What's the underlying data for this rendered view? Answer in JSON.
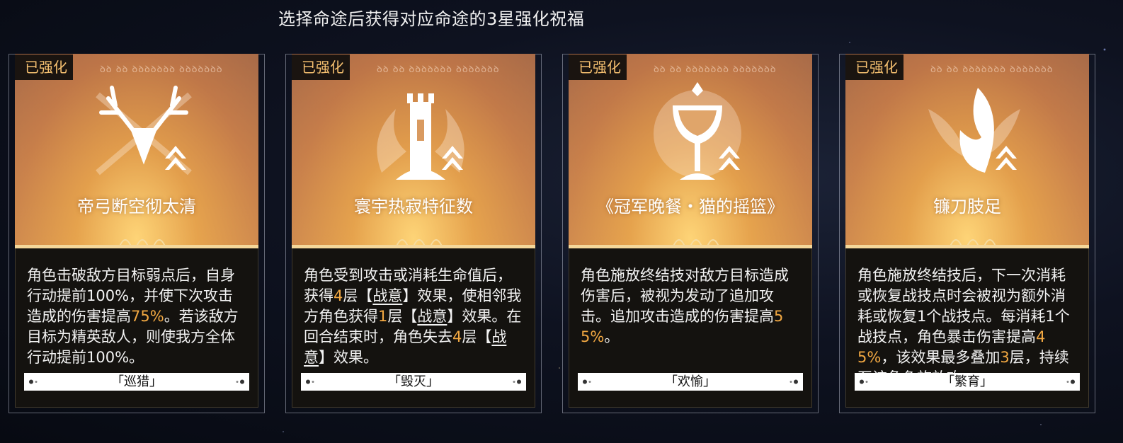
{
  "header": {
    "title": "选择命途后获得对应命途的3星强化祝福"
  },
  "cards": [
    {
      "badge": "已强化",
      "runes": "ꝺꝺ ꝺꝺ ꝺꝺꝺꝺꝺꝺꝺ ꝺꝺꝺꝺꝺꝺꝺ",
      "name": "帝弓断空彻太清",
      "icon": "antler-bow-emblem-icon",
      "desc": [
        {
          "t": "角色击破敌方目标弱点后，自身行动提前100%，并使下次攻击造成的伤害提高"
        },
        {
          "t": "75%",
          "c": "hl"
        },
        {
          "t": "。若该敌方目标为精英敌人，则使我方全体行动提前100%。"
        }
      ],
      "path": "「巡猎」"
    },
    {
      "badge": "已强化",
      "runes": "ꝺꝺ ꝺꝺ ꝺꝺꝺꝺꝺꝺꝺ ꝺꝺꝺꝺꝺꝺꝺ",
      "name": "寰宇热寂特征数",
      "icon": "flaming-tower-emblem-icon",
      "desc": [
        {
          "t": "角色受到攻击或消耗生命值后，获得"
        },
        {
          "t": "4",
          "c": "hl"
        },
        {
          "t": "层【"
        },
        {
          "t": "战意",
          "c": "ul"
        },
        {
          "t": "】效果，使相邻我方角色获得"
        },
        {
          "t": "1",
          "c": "hl"
        },
        {
          "t": "层【"
        },
        {
          "t": "战意",
          "c": "ul"
        },
        {
          "t": "】效果。在回合结束时，角色失去"
        },
        {
          "t": "4",
          "c": "hl"
        },
        {
          "t": "层【"
        },
        {
          "t": "战意",
          "c": "ul"
        },
        {
          "t": "】效果。"
        }
      ],
      "path": "「毁灭」"
    },
    {
      "badge": "已强化",
      "runes": "ꝺꝺ ꝺꝺ ꝺꝺꝺꝺꝺꝺꝺ ꝺꝺꝺꝺꝺꝺꝺ",
      "name": "《冠军晚餐・猫的摇篮》",
      "icon": "goblet-emblem-icon",
      "desc": [
        {
          "t": "角色施放终结技对敌方目标造成伤害后，被视为发动了追加攻击。追加攻击造成的伤害提高"
        },
        {
          "t": "55%",
          "c": "hl"
        },
        {
          "t": "。"
        }
      ],
      "path": "「欢愉」"
    },
    {
      "badge": "已强化",
      "runes": "ꝺꝺ ꝺꝺ ꝺꝺꝺꝺꝺꝺꝺ ꝺꝺꝺꝺꝺꝺꝺ",
      "name": "镰刀肢足",
      "icon": "scythe-limb-emblem-icon",
      "desc": [
        {
          "t": "角色施放终结技后，下一次消耗或恢复战技点时会被视为额外消耗或恢复1个战技点。每消耗1个战技点，角色暴击伤害提高"
        },
        {
          "t": "45%",
          "c": "hl"
        },
        {
          "t": "，该效果最多叠加"
        },
        {
          "t": "3",
          "c": "hl"
        },
        {
          "t": "层，持续至该角色施放攻"
        }
      ],
      "path": "「繁育」"
    }
  ],
  "colors": {
    "highlight": "#f2a842",
    "badge_text": "#f5c070",
    "panel": "#14120f"
  }
}
